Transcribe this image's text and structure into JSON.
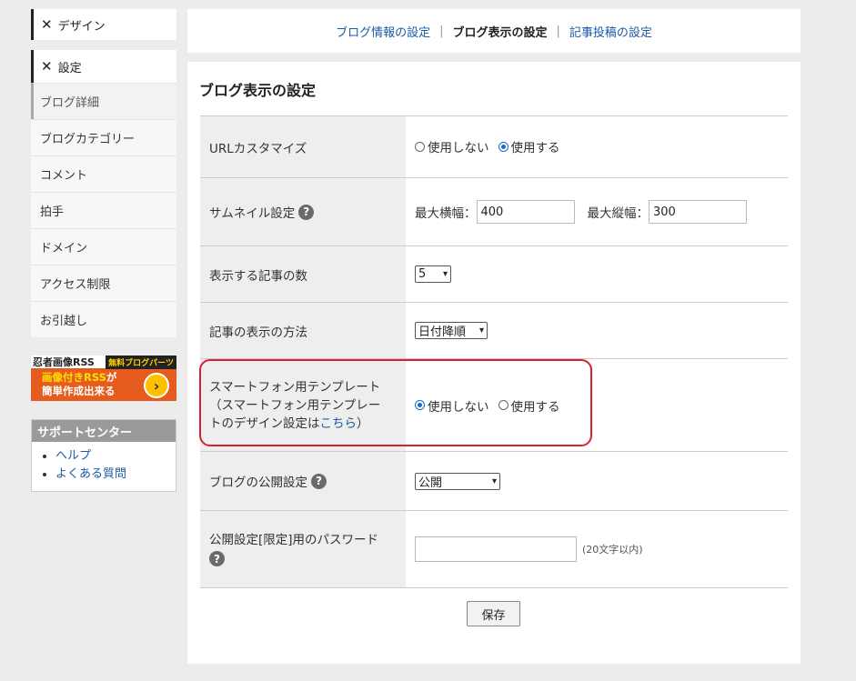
{
  "sidebar": {
    "design_label": "デザイン",
    "settings_label": "設定",
    "items": [
      {
        "label": "ブログ詳細"
      },
      {
        "label": "ブログカテゴリー"
      },
      {
        "label": "コメント"
      },
      {
        "label": "拍手"
      },
      {
        "label": "ドメイン"
      },
      {
        "label": "アクセス制限"
      },
      {
        "label": "お引越し"
      }
    ],
    "banner": {
      "top_left": "忍者画像RSS",
      "top_right": "無料ブログパーツ",
      "line1_a": "画像付き",
      "line1_b": "RSS",
      "line1_c": "が",
      "line2": "簡単作成出来る"
    },
    "support": {
      "title": "サポートセンター",
      "links": [
        "ヘルプ",
        "よくある質問"
      ]
    }
  },
  "tabs": {
    "info": "ブログ情報の設定",
    "sep": "|",
    "display": "ブログ表示の設定",
    "post": "記事投稿の設定"
  },
  "main": {
    "title": "ブログ表示の設定",
    "url_customize": {
      "label": "URLカスタマイズ",
      "option_off": "使用しない",
      "option_on": "使用する",
      "selected": "使用する"
    },
    "thumbnail": {
      "label": "サムネイル設定",
      "max_width_label": "最大横幅：",
      "max_width_value": "400",
      "max_height_label": "最大縦幅：",
      "max_height_value": "300"
    },
    "post_count": {
      "label": "表示する記事の数",
      "value": "5"
    },
    "post_order": {
      "label": "記事の表示の方法",
      "value": "日付降順"
    },
    "smartphone_template": {
      "label_line1": "スマートフォン用テンプレート",
      "label_line2": "（スマートフォン用テンプレー",
      "label_line3_a": "トのデザイン設定は",
      "label_line3_link": "こちら",
      "label_line3_b": "）",
      "option_off": "使用しない",
      "option_on": "使用する",
      "selected": "使用しない"
    },
    "visibility": {
      "label": "ブログの公開設定",
      "value": "公開"
    },
    "password": {
      "label": "公開設定[限定]用のパスワード",
      "value": "",
      "note": "(20文字以内)"
    },
    "save_label": "保存"
  },
  "colors": {
    "accent": "#1b6ac9",
    "highlight_border": "#d8202f",
    "link": "#1a5aa6"
  }
}
